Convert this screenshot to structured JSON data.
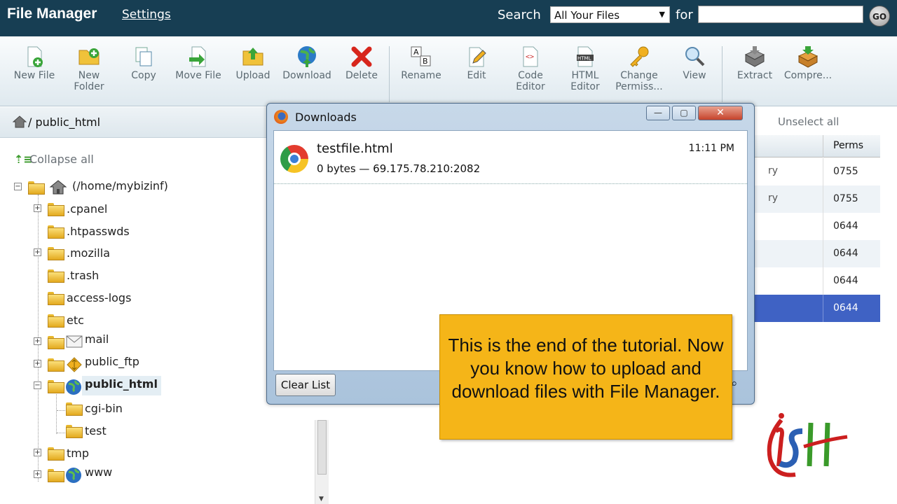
{
  "header": {
    "title": "File Manager",
    "settings_link": "Settings",
    "search_label": "Search",
    "search_scope": "All Your Files",
    "for_label": "for",
    "search_value": "",
    "go_label": "GO"
  },
  "toolbar": {
    "items": [
      {
        "label": "New File",
        "icon": "new-file-icon"
      },
      {
        "label": "New Folder",
        "icon": "new-folder-icon"
      },
      {
        "label": "Copy",
        "icon": "copy-icon"
      },
      {
        "label": "Move File",
        "icon": "move-file-icon"
      },
      {
        "label": "Upload",
        "icon": "upload-icon"
      },
      {
        "label": "Download",
        "icon": "download-icon"
      },
      {
        "label": "Delete",
        "icon": "delete-icon"
      },
      {
        "label": "Rename",
        "icon": "rename-icon"
      },
      {
        "label": "Edit",
        "icon": "edit-icon"
      },
      {
        "label": "Code Editor",
        "icon": "code-editor-icon"
      },
      {
        "label": "HTML Editor",
        "icon": "html-editor-icon"
      },
      {
        "label": "Change Permiss...",
        "icon": "change-permissions-icon"
      },
      {
        "label": "View",
        "icon": "view-icon"
      },
      {
        "label": "Extract",
        "icon": "extract-icon"
      },
      {
        "label": "Compre...",
        "icon": "compress-icon"
      }
    ]
  },
  "path": {
    "current": "/ public_html"
  },
  "tree": {
    "collapse_label": "Collapse all",
    "root": "(/home/mybizinf)",
    "items": [
      {
        "label": ".cpanel"
      },
      {
        "label": ".htpasswds"
      },
      {
        "label": ".mozilla"
      },
      {
        "label": ".trash"
      },
      {
        "label": "access-logs"
      },
      {
        "label": "etc"
      },
      {
        "label": "mail"
      },
      {
        "label": "public_ftp"
      },
      {
        "label": "public_html"
      },
      {
        "label": "cgi-bin"
      },
      {
        "label": "test"
      },
      {
        "label": "tmp"
      },
      {
        "label": "www"
      }
    ]
  },
  "file_table": {
    "unselect_all": "Unselect all",
    "perms_header": "Perms",
    "rows": [
      {
        "type_fragment": "ry",
        "perms": "0755"
      },
      {
        "type_fragment": "ry",
        "perms": "0755"
      },
      {
        "type_fragment": "",
        "perms": "0644"
      },
      {
        "type_fragment": "",
        "perms": "0644"
      },
      {
        "type_fragment": "",
        "perms": "0644"
      },
      {
        "type_fragment": "",
        "perms": "0644"
      }
    ]
  },
  "downloads_window": {
    "title": "Downloads",
    "minimize": "—",
    "maximize": "▢",
    "close": "✕",
    "item": {
      "filename": "testfile.html",
      "info": "0 bytes — 69.175.78.210:2082",
      "time": "11:11 PM"
    },
    "clear_list": "Clear List"
  },
  "callout": {
    "text": "This is the end of the tutorial. Now you know how to upload and download files with File Manager."
  },
  "colors": {
    "header_bg": "#173e53",
    "callout_bg": "#f5b518",
    "selected_row": "#3f62c4"
  }
}
